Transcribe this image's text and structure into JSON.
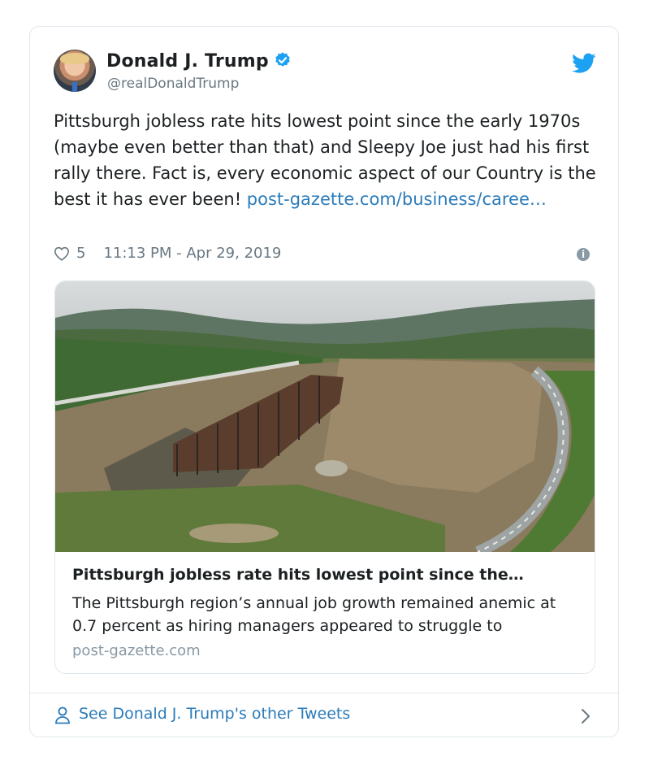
{
  "tweet": {
    "author_name": "Donald J. Trump",
    "handle": "@realDonaldTrump",
    "text": "Pittsburgh jobless rate hits lowest point since the early 1970s (maybe even better than that) and Sleepy Joe just had his first rally there. Fact is, every economic aspect of our Country is the best it has ever been! ",
    "link_text": "post-gazette.com/business/caree…",
    "likes": "5",
    "timestamp": "11:13 PM - Apr 29, 2019"
  },
  "link_card": {
    "title": "Pittsburgh jobless rate hits lowest point since the…",
    "description": "The Pittsburgh region’s annual job growth remained anemic at 0.7 percent as hiring managers appeared to struggle to",
    "domain": "post-gazette.com"
  },
  "footer": {
    "label": "See Donald J. Trump's other Tweets"
  },
  "icons": {
    "verified": "verified-badge-icon",
    "twitter": "twitter-bird-icon",
    "like": "heart-icon",
    "info": "info-icon",
    "person": "person-icon",
    "chevron": "chevron-right-icon"
  },
  "colors": {
    "link": "#2b7bb9",
    "verified": "#1da1f2",
    "muted": "#697882",
    "border": "#e1e8ed"
  }
}
